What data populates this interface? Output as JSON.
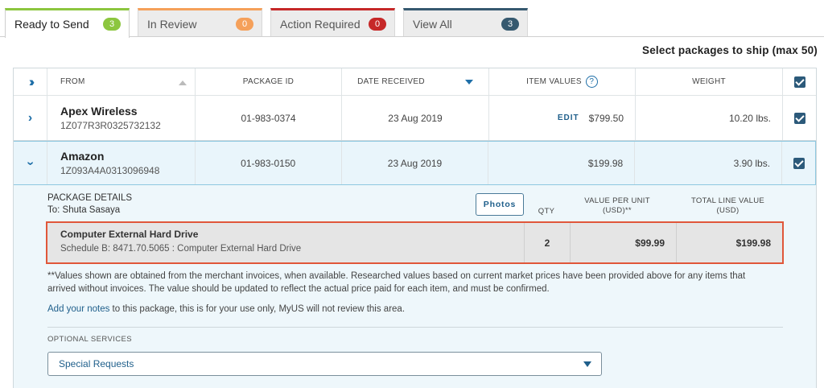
{
  "tabs": [
    {
      "label": "Ready to Send",
      "count": "3",
      "color": "#8cc63f",
      "active": true
    },
    {
      "label": "In Review",
      "count": "0",
      "color": "#f5a05a",
      "active": false
    },
    {
      "label": "Action Required",
      "count": "0",
      "color": "#c62828",
      "active": false
    },
    {
      "label": "View All",
      "count": "3",
      "color": "#36596f",
      "active": false
    }
  ],
  "select_title": "Select packages to ship (max 50)",
  "header": {
    "from": "FROM",
    "package_id": "PACKAGE ID",
    "date_received": "DATE RECEIVED",
    "item_values": "ITEM VALUES",
    "weight": "WEIGHT"
  },
  "packages": [
    {
      "from": "Apex Wireless",
      "tracking": "1Z077R3R0325732132",
      "package_id": "01-983-0374",
      "date": "23 Aug 2019",
      "edit": "EDIT",
      "value": "$799.50",
      "weight": "10.20 lbs."
    },
    {
      "from": "Amazon",
      "tracking": "1Z093A4A0313096948",
      "package_id": "01-983-0150",
      "date": "23 Aug 2019",
      "value": "$199.98",
      "weight": "3.90 lbs."
    }
  ],
  "details": {
    "title": "PACKAGE DETAILS",
    "to": "To: Shuta Sasaya",
    "photos": "Photos",
    "qty_header": "QTY",
    "unit_header_1": "VALUE PER UNIT",
    "unit_header_2": "(USD)**",
    "total_header_1": "TOTAL LINE VALUE",
    "total_header_2": "(USD)",
    "item": {
      "name": "Computer External Hard Drive",
      "schedule": "Schedule B: 8471.70.5065 : Computer External Hard Drive",
      "qty": "2",
      "unit_value": "$99.99",
      "total_value": "$199.98"
    },
    "footnote": "**Values shown are obtained from the merchant invoices, when available. Researched values based on current market prices have been provided above for any items that arrived without invoices. The value should be updated to reflect the actual price paid for each item, and must be confirmed.",
    "notes_link": "Add your notes",
    "notes_text": " to this package, this is for your use only, MyUS will not review this area.",
    "optional_label": "OPTIONAL SERVICES",
    "select_value": "Special Requests"
  },
  "icons": {
    "expand_all": "double-chevron-right-icon",
    "expand_row": "chevron-right-icon",
    "collapse_row": "chevron-down-icon",
    "help": "question-circle-icon",
    "checkbox": "checkbox-checked-icon"
  },
  "colors": {
    "accent": "#1f6fa8",
    "highlight_border": "#e0573a",
    "checkbox": "#2c5a7a"
  }
}
